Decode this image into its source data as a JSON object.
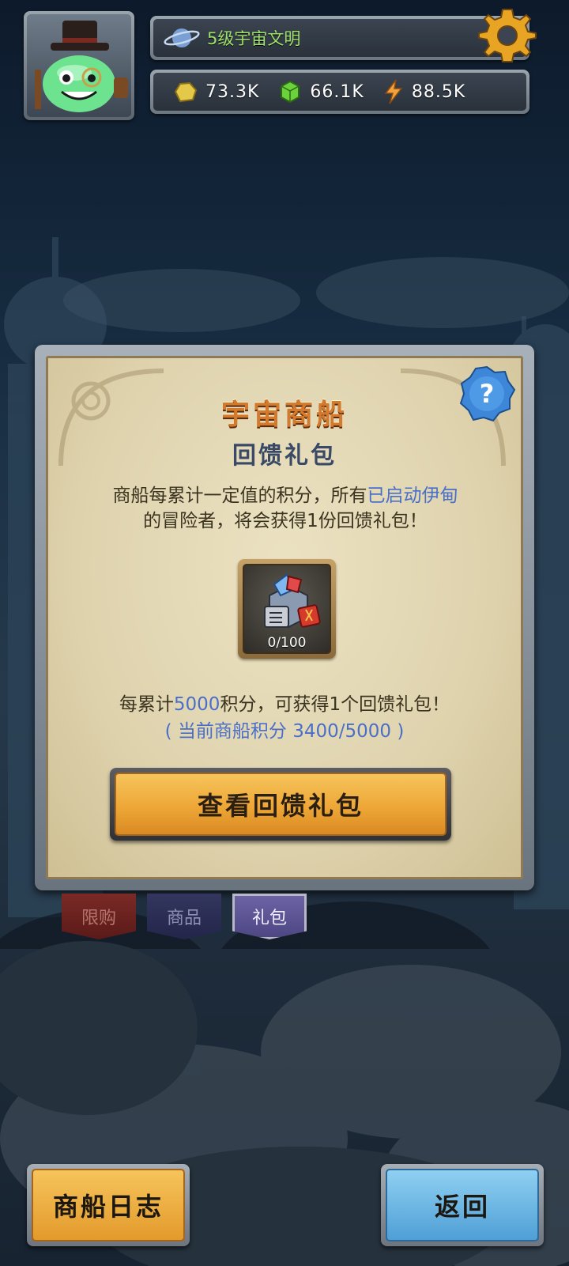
{
  "hud": {
    "level_text": "5级宇宙文明",
    "resources": [
      {
        "icon": "gold-ore-icon",
        "value": "73.3K"
      },
      {
        "icon": "green-crystal-icon",
        "value": "66.1K"
      },
      {
        "icon": "lightning-energy-icon",
        "value": "88.5K"
      }
    ]
  },
  "panel": {
    "title": "宇宙商船",
    "subtitle": "回馈礼包",
    "desc_part1": "商船每累计一定值的积分，所有",
    "desc_highlight": "已启动伊甸",
    "desc_part2": "的冒险者，将会获得1份回馈礼包！",
    "item_count": "0/100",
    "note_part1": "每累计",
    "note_highlight": "5000",
    "note_part2": "积分，可获得1个回馈礼包！",
    "note_current": "( 当前商船积分 3400/5000 )",
    "view_button": "查看回馈礼包"
  },
  "tabs": {
    "limited": "限购",
    "goods": "商品",
    "gift": "礼包"
  },
  "bottom": {
    "log_button": "商船日志",
    "back_button": "返回"
  },
  "colors": {
    "title_orange": "#d47a2c",
    "highlight_blue": "#4a6fc9",
    "level_green": "#9fe36d",
    "button_gold": "#eea737",
    "button_blue": "#4f9fd6"
  }
}
